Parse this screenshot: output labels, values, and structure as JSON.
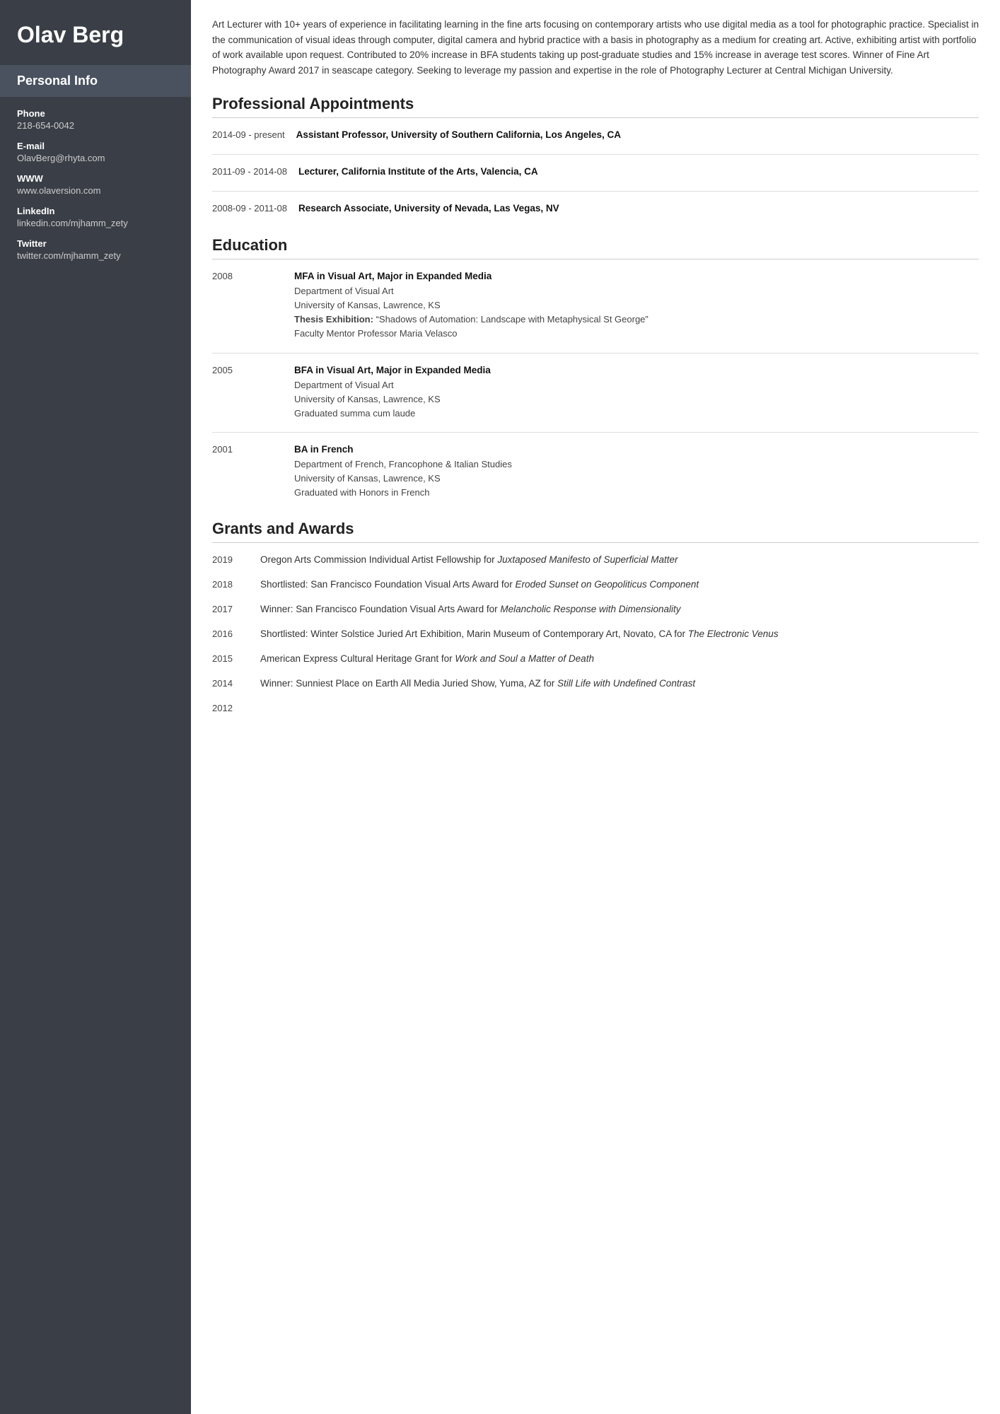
{
  "sidebar": {
    "name": "Olav Berg",
    "personal_info_label": "Personal Info",
    "items": [
      {
        "label": "Phone",
        "value": "218-654-0042"
      },
      {
        "label": "E-mail",
        "value": "OlavBerg@rhyta.com"
      },
      {
        "label": "WWW",
        "value": "www.olaversion.com"
      },
      {
        "label": "LinkedIn",
        "value": "linkedin.com/mjhamm_zety"
      },
      {
        "label": "Twitter",
        "value": "twitter.com/mjhamm_zety"
      }
    ]
  },
  "summary": "Art Lecturer with 10+ years of experience in facilitating learning in the fine arts focusing on contemporary artists who use digital media as a tool for photographic practice. Specialist in the communication of visual ideas through computer, digital camera and hybrid practice with a basis in photography as a medium for creating art. Active, exhibiting artist with portfolio of work available upon request. Contributed to 20% increase in BFA students taking up post-graduate studies and 15% increase in average test scores. Winner of Fine Art Photography Award 2017 in seascape category. Seeking to leverage my passion and expertise in the role of Photography Lecturer at Central Michigan University.",
  "sections": {
    "appointments": {
      "title": "Professional Appointments",
      "entries": [
        {
          "date": "2014-09 - present",
          "title": "Assistant Professor, University of Southern California, Los Angeles, CA",
          "details": []
        },
        {
          "date": "2011-09 - 2014-08",
          "title": "Lecturer, California Institute of the Arts, Valencia, CA",
          "details": []
        },
        {
          "date": "2008-09 - 2011-08",
          "title": "Research Associate, University of Nevada, Las Vegas, NV",
          "details": []
        }
      ]
    },
    "education": {
      "title": "Education",
      "entries": [
        {
          "year": "2008",
          "degree": "MFA in Visual Art, Major in Expanded Media",
          "dept": "Department of Visual Art",
          "school": "University of Kansas, Lawrence, KS",
          "thesis_label": "Thesis Exhibition:",
          "thesis": "“Shadows of Automation: Landscape with Metaphysical St George”",
          "mentor": "Faculty Mentor Professor Maria Velasco",
          "graduated": ""
        },
        {
          "year": "2005",
          "degree": "BFA in Visual Art, Major in Expanded Media",
          "dept": "Department of Visual Art",
          "school": "University of Kansas, Lawrence, KS",
          "thesis_label": "",
          "thesis": "",
          "mentor": "",
          "graduated": "Graduated summa cum laude"
        },
        {
          "year": "2001",
          "degree": "BA in French",
          "dept": "Department of French, Francophone & Italian Studies",
          "school": "University of Kansas, Lawrence, KS",
          "thesis_label": "",
          "thesis": "",
          "mentor": "",
          "graduated": "Graduated with Honors in French"
        }
      ]
    },
    "grants": {
      "title": "Grants and Awards",
      "entries": [
        {
          "year": "2019",
          "text": "Oregon Arts Commission Individual Artist Fellowship for ",
          "italic": "Juxtaposed Manifesto of Superficial Matter",
          "text2": ""
        },
        {
          "year": "2018",
          "text": "Shortlisted: San Francisco Foundation Visual Arts Award for ",
          "italic": "Eroded Sunset on Geopoliticus Component",
          "text2": ""
        },
        {
          "year": "2017",
          "text": "Winner: San Francisco Foundation Visual Arts Award for ",
          "italic": "Melancholic Response with Dimensionality",
          "text2": ""
        },
        {
          "year": "2016",
          "text": "Shortlisted: Winter Solstice Juried Art Exhibition, Marin Museum of Contemporary Art, Novato, CA for ",
          "italic": "The Electronic Venus",
          "text2": ""
        },
        {
          "year": "2015",
          "text": "American Express Cultural Heritage Grant for ",
          "italic": "Work and Soul a Matter of Death",
          "text2": ""
        },
        {
          "year": "2014",
          "text": "Winner: Sunniest Place on Earth All Media Juried Show, Yuma, AZ for ",
          "italic": "Still Life with Undefined Contrast",
          "text2": ""
        },
        {
          "year": "2012",
          "text": "",
          "italic": "",
          "text2": ""
        }
      ]
    }
  }
}
